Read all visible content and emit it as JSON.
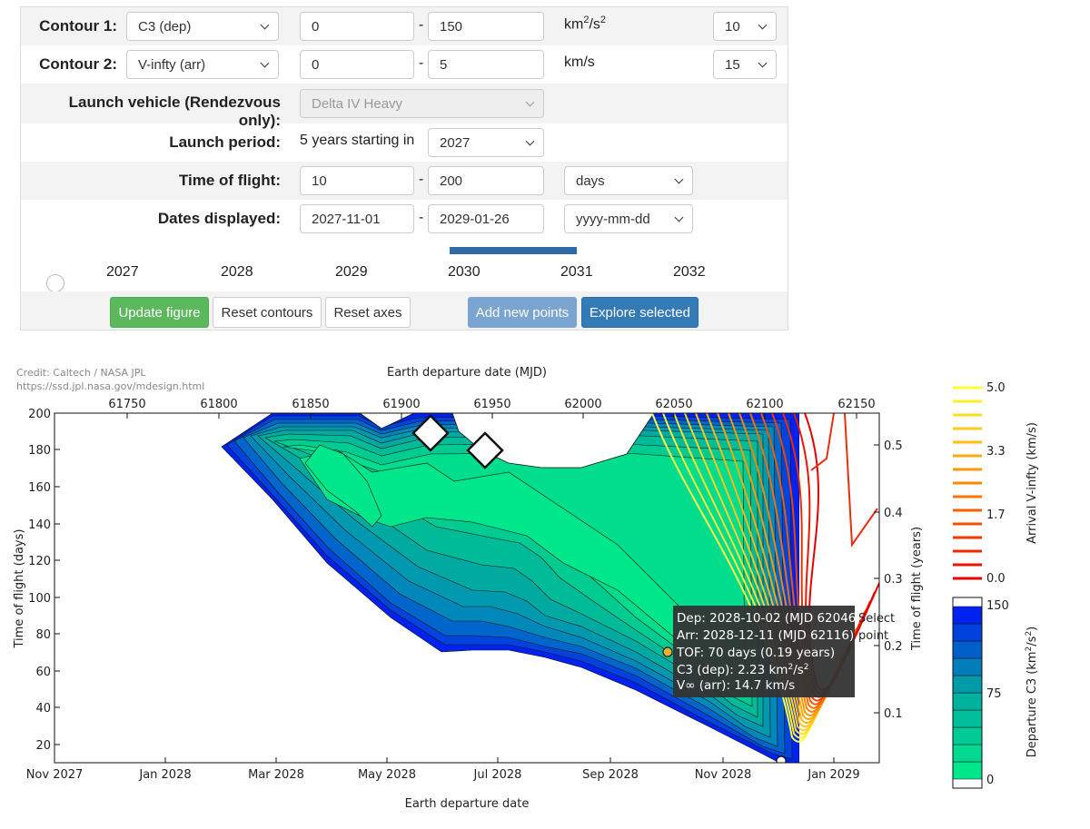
{
  "form": {
    "contour1": {
      "label": "Contour 1:",
      "select": "C3 (dep)",
      "min": "0",
      "max": "150",
      "unit": "km",
      "unit_sup1": "2",
      "unit_mid": "/s",
      "unit_sup2": "2",
      "levels": "10"
    },
    "contour2": {
      "label": "Contour 2:",
      "select": "V-infty (arr)",
      "min": "0",
      "max": "5",
      "unit": "km/s",
      "levels": "15"
    },
    "launch_vehicle": {
      "label": "Launch vehicle (Rendezvous only):",
      "value": "Delta IV Heavy"
    },
    "launch_period": {
      "label": "Launch period:",
      "text": "5 years starting in",
      "year": "2027"
    },
    "time_of_flight": {
      "label": "Time of flight:",
      "min": "10",
      "max": "200",
      "unit": "days"
    },
    "dates_displayed": {
      "label": "Dates displayed:",
      "start": "2027-11-01",
      "end": "2029-01-26",
      "format": "yyyy-mm-dd"
    },
    "year_slider": {
      "years": [
        "2027",
        "2028",
        "2029",
        "2030",
        "2031",
        "2032"
      ],
      "selection_start": 2029.88,
      "selection_end": 2031.0
    },
    "buttons": {
      "update": "Update figure",
      "reset_contours": "Reset contours",
      "reset_axes": "Reset axes",
      "add_points": "Add new points",
      "explore": "Explore selected"
    }
  },
  "plot": {
    "credit_line1": "Credit: Caltech / NASA JPL",
    "credit_line2": "https://ssd.jpl.nasa.gov/mdesign.html",
    "top_axis_title": "Earth departure date (MJD)",
    "top_ticks": [
      "61750",
      "61800",
      "61850",
      "61900",
      "61950",
      "62000",
      "62050",
      "62100",
      "62150"
    ],
    "bottom_axis_title": "Earth departure date",
    "bottom_ticks": [
      "Nov 2027",
      "Jan 2028",
      "Mar 2028",
      "May 2028",
      "Jul 2028",
      "Sep 2028",
      "Nov 2028",
      "Jan 2029"
    ],
    "left_axis_title": "Time of flight (days)",
    "left_ticks": [
      "200",
      "180",
      "160",
      "140",
      "120",
      "100",
      "80",
      "60",
      "40",
      "20"
    ],
    "right_axis_title": "Time of flight (years)",
    "right_ticks": [
      "0.5",
      "0.4",
      "0.3",
      "0.2",
      "0.1"
    ],
    "tooltip": {
      "dep": "Dep: 2028-10-02 (MJD 62046)",
      "arr": "Arr: 2028-12-11 (MJD 62116)",
      "tof": "TOF: 70 days (0.19 years)",
      "c3_prefix": "C3 (dep): 2.23 km",
      "c3_sup1": "2",
      "c3_mid": "/s",
      "c3_sup2": "2",
      "vinf": "V∞ (arr): 14.7 km/s"
    },
    "select_point_line1": "Select",
    "select_point_line2": "point",
    "colorbar_vinf": {
      "title": "Arrival V-infty (km/s)",
      "ticks": [
        "5.0",
        "3.3",
        "1.7",
        "0.0"
      ]
    },
    "colorbar_c3": {
      "title_prefix": "Departure C3 (km",
      "title_sup1": "2",
      "title_mid": "/s",
      "title_sup2": "2",
      "title_suffix": ")",
      "ticks": [
        "150",
        "75",
        "0"
      ]
    },
    "colors": {
      "c3_low": "#00e68a",
      "c3_mid": "#00aaa0",
      "c3_high": "#0022ee",
      "vinf_low": "#e60000",
      "vinf_high": "#ffff33"
    }
  },
  "chart_data": {
    "type": "contour",
    "x_label": "Earth departure date",
    "x_label_top": "Earth departure date (MJD)",
    "y_label": "Time of flight (days)",
    "y2_label": "Time of flight (years)",
    "x_range_mjd": [
      61710,
      62160
    ],
    "x_range_dates": [
      "2027-11-01",
      "2029-01-26"
    ],
    "y_range_days": [
      10,
      200
    ],
    "c3_contour_range": [
      0,
      150
    ],
    "c3_levels": 10,
    "vinf_contour_range": [
      0,
      5
    ],
    "vinf_levels": 15,
    "selected_point": {
      "dep_mjd": 62046,
      "arr_mjd": 62116,
      "tof_days": 70,
      "c3": 2.23,
      "vinf": 14.7
    }
  }
}
